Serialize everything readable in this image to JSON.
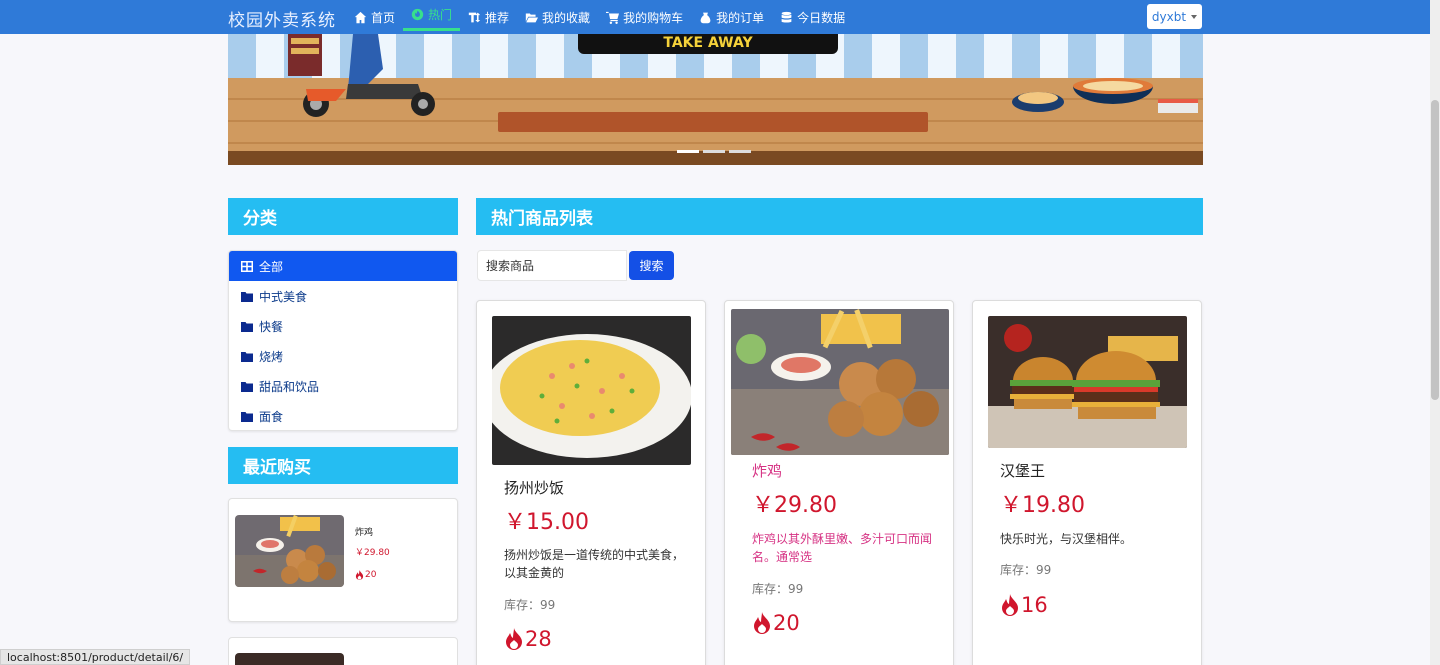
{
  "app": {
    "title": "校园外卖系统"
  },
  "nav": {
    "items": [
      {
        "label": "首页",
        "icon": "home-icon"
      },
      {
        "label": "热门",
        "icon": "flame-icon"
      },
      {
        "label": "推荐",
        "icon": "text-height-icon"
      },
      {
        "label": "我的收藏",
        "icon": "folder-open-icon"
      },
      {
        "label": "我的购物车",
        "icon": "cart-icon"
      },
      {
        "label": "我的订单",
        "icon": "bag-icon"
      },
      {
        "label": "今日数据",
        "icon": "database-icon"
      }
    ],
    "active": "热门",
    "user": "dyxbt"
  },
  "banner": {
    "logo_text": "TAKE AWAY",
    "slides": 3,
    "active_slide": 1
  },
  "sidebar": {
    "category_title": "分类",
    "categories": [
      {
        "label": "全部",
        "icon": "grid-icon",
        "active": true
      },
      {
        "label": "中式美食",
        "icon": "folder-icon"
      },
      {
        "label": "快餐",
        "icon": "folder-icon"
      },
      {
        "label": "烧烤",
        "icon": "folder-icon"
      },
      {
        "label": "甜品和饮品",
        "icon": "folder-icon"
      },
      {
        "label": "面食",
        "icon": "folder-icon"
      }
    ],
    "recent_title": "最近购买",
    "recent": [
      {
        "name": "炸鸡",
        "price": "￥29.80",
        "sales": "20"
      }
    ]
  },
  "main": {
    "title": "热门商品列表",
    "search": {
      "placeholder": "搜索商品",
      "button": "搜索"
    },
    "products": [
      {
        "name": "扬州炒饭",
        "price": "￥15.00",
        "desc": "扬州炒饭是一道传统的中式美食，以其金黄的",
        "stock": "库存：99",
        "sales": "28"
      },
      {
        "name": "炸鸡",
        "price": "￥29.80",
        "desc": "炸鸡以其外酥里嫩、多汁可口而闻名。通常选",
        "stock": "库存：99",
        "sales": "20"
      },
      {
        "name": "汉堡王",
        "price": "￥19.80",
        "desc": "快乐时光，与汉堡相伴。",
        "stock": "库存：99",
        "sales": "16"
      }
    ]
  },
  "status_url": "localhost:8501/product/detail/6/",
  "colors": {
    "navbar": "#2f7ad8",
    "panel_header": "#25bdf2",
    "active_nav": "#37e08c",
    "active_category": "#1058f0",
    "price": "#d0162d"
  }
}
